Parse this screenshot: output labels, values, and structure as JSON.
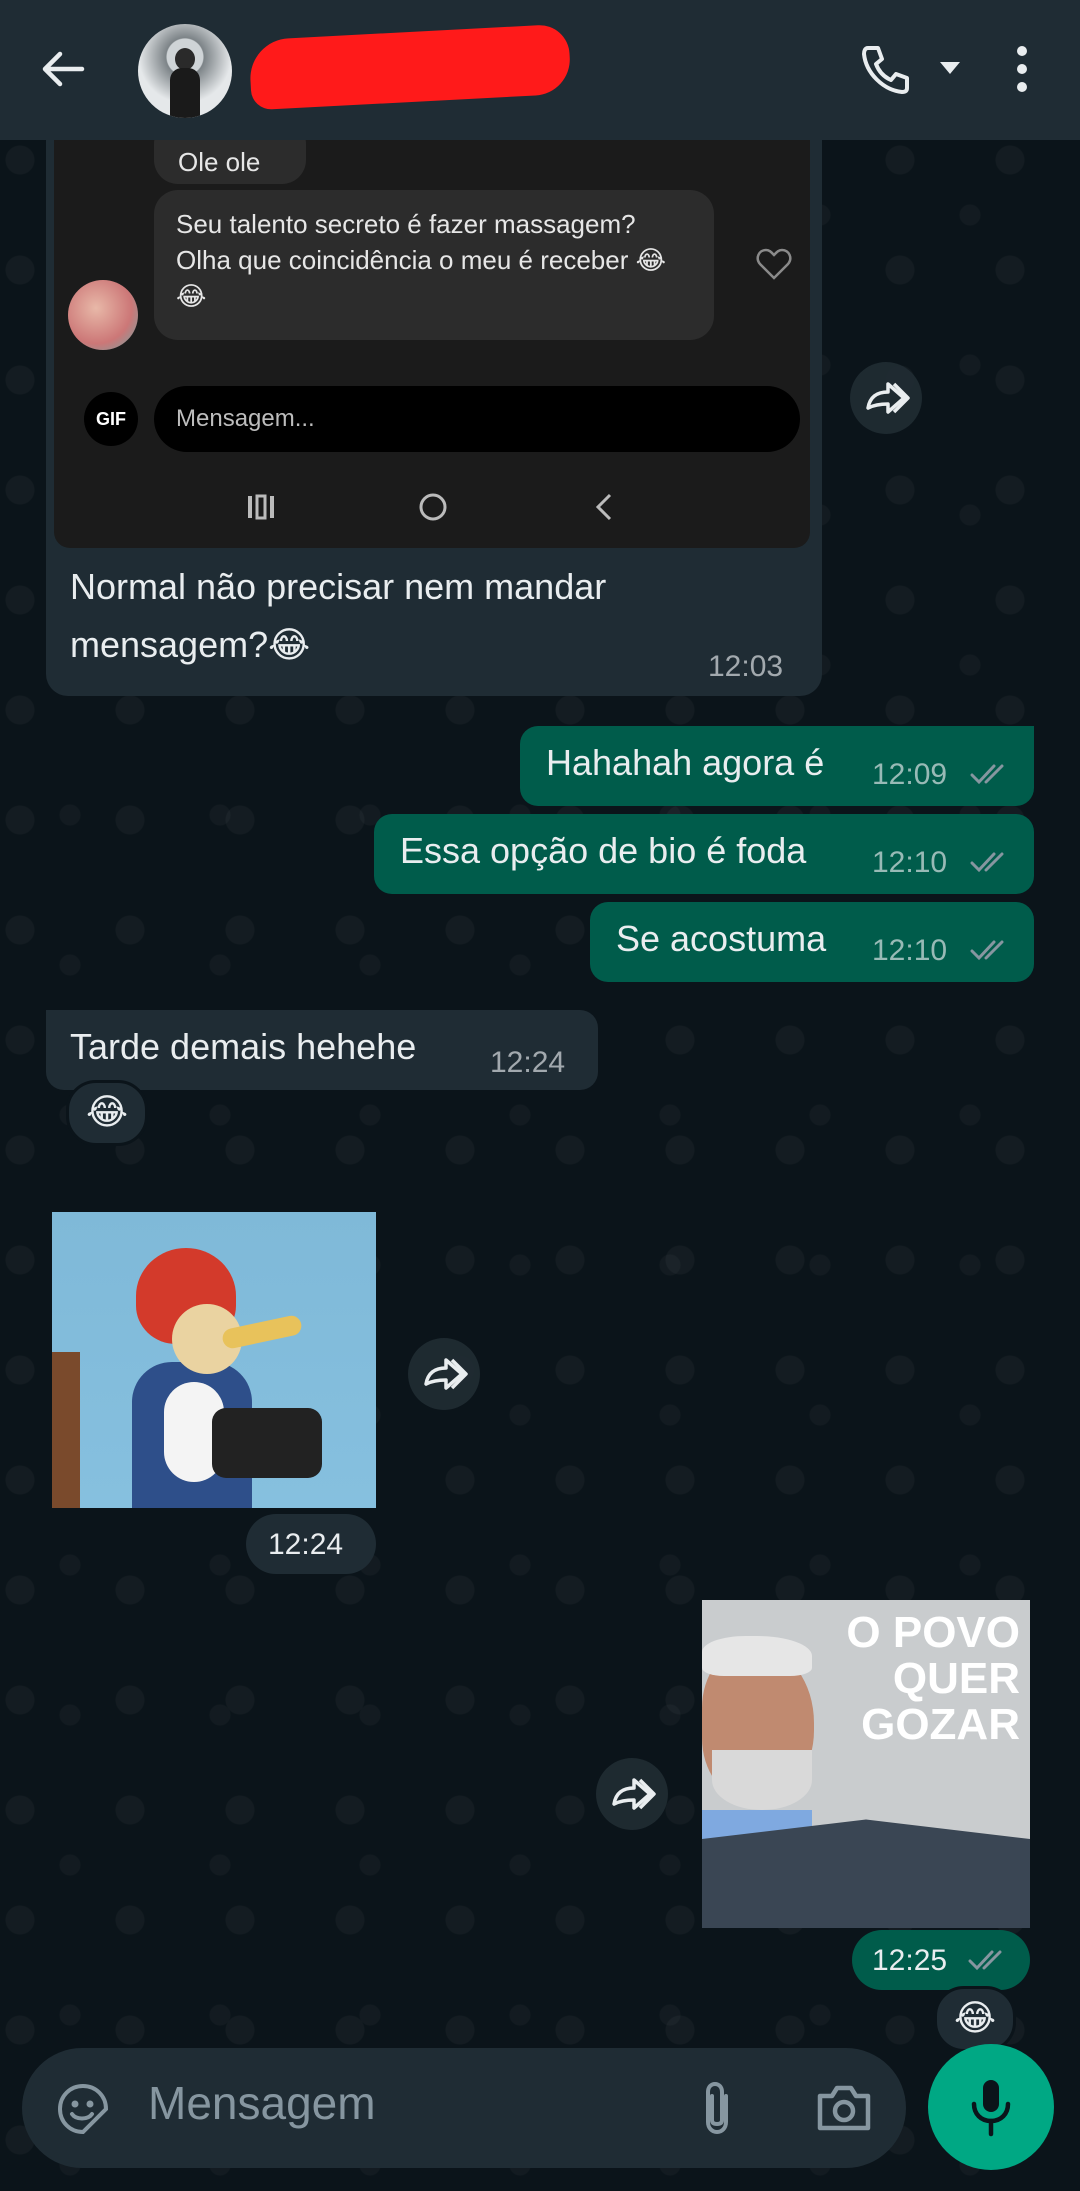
{
  "header": {
    "contact_name": "",
    "back_icon": "arrow-left-icon",
    "call_icon": "phone-icon",
    "menu_icon": "more-vertical-icon"
  },
  "forwarded_screenshot": {
    "top_bubble_partial": "Ole ole",
    "message": "Seu talento secreto é fazer massagem? Olha que coincidência o meu é receber 😂😂",
    "gif_label": "GIF",
    "input_placeholder": "Mensagem..."
  },
  "messages": [
    {
      "id": "m1",
      "direction": "in",
      "text_line1": "Normal não precisar nem mandar",
      "text_line2": "mensagem?😂",
      "time": "12:03"
    },
    {
      "id": "m2",
      "direction": "out",
      "text": "Hahahah agora é",
      "time": "12:09"
    },
    {
      "id": "m3",
      "direction": "out",
      "text": "Essa opção de bio é foda",
      "time": "12:10"
    },
    {
      "id": "m4",
      "direction": "out",
      "text": "Se acostuma",
      "time": "12:10"
    },
    {
      "id": "m5",
      "direction": "in",
      "text": "Tarde demais hehehe",
      "time": "12:24",
      "reaction": "😂"
    },
    {
      "id": "m6",
      "direction": "in",
      "type": "sticker",
      "time": "12:24"
    },
    {
      "id": "m7",
      "direction": "out",
      "type": "sticker",
      "sticker_text": "O POVO QUER GOZAR",
      "time": "12:25",
      "reaction": "😂"
    }
  ],
  "composer": {
    "placeholder": "Mensagem",
    "emoji_icon": "sticker-emoji-icon",
    "attach_icon": "paperclip-icon",
    "camera_icon": "camera-icon",
    "mic_icon": "microphone-icon"
  },
  "colors": {
    "background": "#0b141a",
    "incoming_bubble": "#1f2c34",
    "outgoing_bubble": "#005c4b",
    "accent": "#00a884",
    "read_ticks": "#8696a0"
  }
}
